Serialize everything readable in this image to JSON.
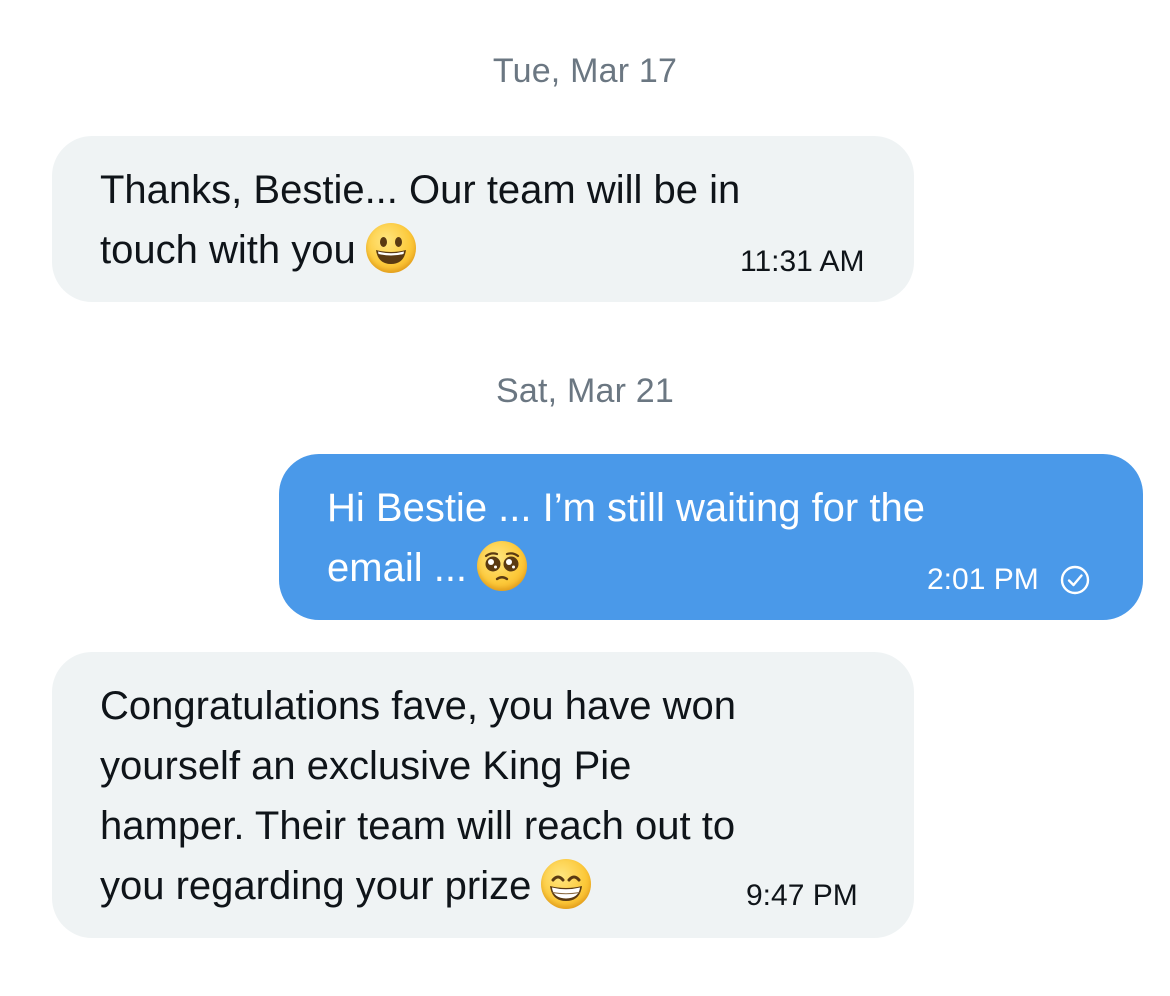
{
  "conversation": {
    "groups": [
      {
        "date": "Tue, Mar 17",
        "messages": [
          {
            "direction": "incoming",
            "lines": [
              "Thanks, Bestie... Our team will be in",
              "touch with you"
            ],
            "emoji": "grinning-face-emoji",
            "time": "11:31 AM"
          }
        ]
      },
      {
        "date": "Sat, Mar 21",
        "messages": [
          {
            "direction": "outgoing",
            "lines": [
              "Hi Bestie ... I’m still waiting for the",
              "email ..."
            ],
            "emoji": "pleading-face-emoji",
            "time": "2:01 PM",
            "status_icon": "read-check-icon"
          },
          {
            "direction": "incoming",
            "lines": [
              "Congratulations fave, you have won",
              "yourself an exclusive King Pie",
              "hamper. Their team will reach out to",
              "you regarding your prize"
            ],
            "emoji": "beaming-face-emoji",
            "time": "9:47 PM"
          }
        ]
      }
    ]
  },
  "colors": {
    "incoming_bubble": "#eff3f4",
    "outgoing_bubble": "#4a99e9",
    "date_text": "#6b7782",
    "incoming_text": "#0f1419",
    "outgoing_text": "#ffffff"
  }
}
